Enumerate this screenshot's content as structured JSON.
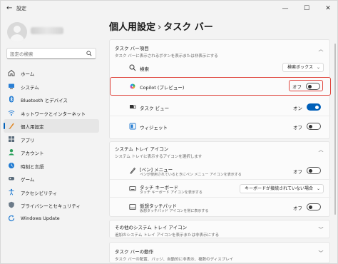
{
  "window": {
    "title": "設定"
  },
  "sidebar": {
    "search_placeholder": "設定の検索",
    "items": [
      {
        "label": "ホーム",
        "icon": "home-icon"
      },
      {
        "label": "システム",
        "icon": "system-icon"
      },
      {
        "label": "Bluetooth とデバイス",
        "icon": "bluetooth-icon"
      },
      {
        "label": "ネットワークとインターネット",
        "icon": "network-icon"
      },
      {
        "label": "個人用設定",
        "icon": "personalization-icon",
        "active": true
      },
      {
        "label": "アプリ",
        "icon": "apps-icon"
      },
      {
        "label": "アカウント",
        "icon": "account-icon"
      },
      {
        "label": "時刻と言語",
        "icon": "time-language-icon"
      },
      {
        "label": "ゲーム",
        "icon": "game-icon"
      },
      {
        "label": "アクセシビリティ",
        "icon": "accessibility-icon"
      },
      {
        "label": "プライバシーとセキュリティ",
        "icon": "privacy-icon"
      },
      {
        "label": "Windows Update",
        "icon": "update-icon"
      }
    ]
  },
  "breadcrumb": {
    "parent": "個人用設定",
    "separator": "›",
    "current": "タスク バー"
  },
  "taskbar_items": {
    "title": "タスク バー項目",
    "subtitle": "タスク バーに表示されるボタンを表示または非表示にする",
    "search": {
      "label": "検索",
      "value": "検索ボックス"
    },
    "copilot": {
      "label": "Copilot (プレビュー)",
      "state": "オフ",
      "on": false
    },
    "taskview": {
      "label": "タスク ビュー",
      "state": "オン",
      "on": true
    },
    "widgets": {
      "label": "ウィジェット",
      "state": "オフ",
      "on": false
    }
  },
  "system_tray": {
    "title": "システム トレイ アイコン",
    "subtitle": "システム トレイに表示するアイコンを選択します",
    "pen": {
      "label": "[ペン] メニュー",
      "sub": "ペンが使用されているときにペン メニュー アイコンを表示する",
      "state": "オフ",
      "on": false
    },
    "touch_keyboard": {
      "label": "タッチ キーボード",
      "sub": "タッチ キーボード アイコンを表示する",
      "value": "キーボードが接続されていない場合"
    },
    "touchpad": {
      "label": "仮想タッチパッド",
      "sub": "仮想タッチパッド アイコンを常に表示する",
      "state": "オフ",
      "on": false
    }
  },
  "other_tray": {
    "title": "その他のシステム トレイ アイコン",
    "subtitle": "追加のシステム トレイ アイコンを表示または非表示にする"
  },
  "behaviors": {
    "title": "タスク バーの動作",
    "subtitle": "タスク バーの配置、バッジ、自動的に非表示、複数のディスプレイ"
  },
  "colors": {
    "accent": "#005fb8",
    "highlight": "#e0473f"
  }
}
